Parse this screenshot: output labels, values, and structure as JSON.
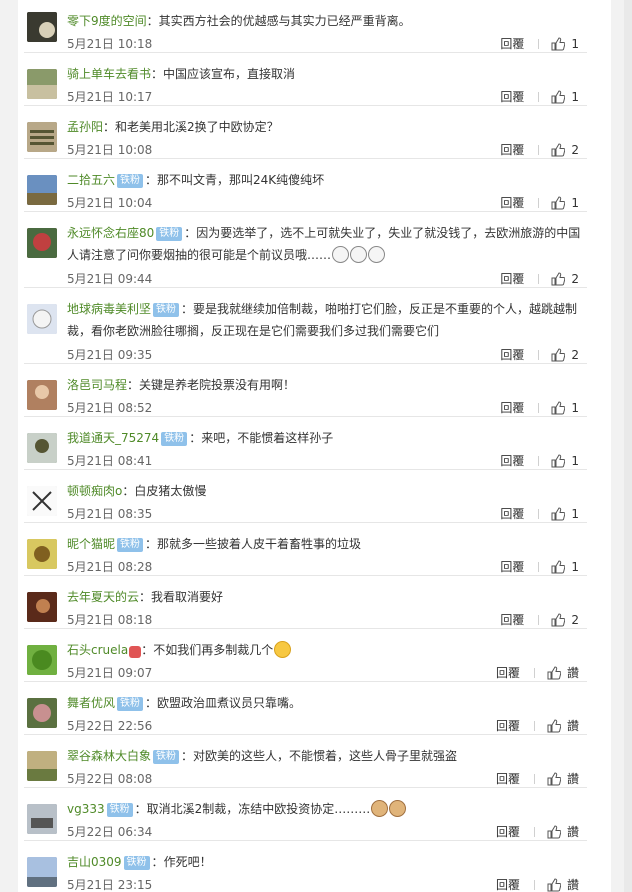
{
  "comments": [
    {
      "user": "零下9度的空间",
      "badge": "",
      "text": "其实西方社会的优越感与其实力已经严重背离。",
      "text2": "",
      "emoji": "",
      "time": "5月21日 10:18",
      "reply": "回覆",
      "likes": "1",
      "avatar_color": "#4a4a3a"
    },
    {
      "user": "骑上单车去看书",
      "badge": "",
      "text": "中国应该宣布，直接取消",
      "text2": "",
      "emoji": "",
      "time": "5月21日 10:17",
      "reply": "回覆",
      "likes": "1",
      "avatar_color": "#7a8a5a"
    },
    {
      "user": "孟孙阳",
      "badge": "",
      "text": "和老美用北溪2换了中欧协定？",
      "text2": "",
      "emoji": "",
      "time": "5月21日 10:08",
      "reply": "回覆",
      "likes": "2",
      "avatar_color": "#8a7a60"
    },
    {
      "user": "二拾五六",
      "badge": "铁粉",
      "text": "那不叫文青，那叫24K纯傻纯坏",
      "text2": "",
      "emoji": "",
      "time": "5月21日 10:04",
      "reply": "回覆",
      "likes": "1",
      "avatar_color": "#5a7aa0"
    },
    {
      "user": "永远怀念右座80",
      "badge": "铁粉",
      "text": "因为要选举了，选不上可就失业了，失业了就没钱了，去欧洲旅游的中国",
      "text2": "人请注意了问你要烟抽的很可能是个前议员哦……",
      "emoji": "face3",
      "time": "5月21日 09:44",
      "reply": "回覆",
      "likes": "2",
      "avatar_color": "#a04040"
    },
    {
      "user": "地球病毒美利坚",
      "badge": "铁粉",
      "text": "要是我就继续加倍制裁，啪啪打它们脸，反正是不重要的个人，越跳越制",
      "text2": "裁，看你老欧洲脸往哪搁，反正现在是它们需要我们多过我们需要它们",
      "emoji": "",
      "time": "5月21日 09:35",
      "reply": "回覆",
      "likes": "2",
      "avatar_color": "#c0c0d0"
    },
    {
      "user": "洛邑司马程",
      "badge": "",
      "text": "关键是养老院投票没有用啊！",
      "text2": "",
      "emoji": "",
      "time": "5月21日 08:52",
      "reply": "回覆",
      "likes": "1",
      "avatar_color": "#9a6a50"
    },
    {
      "user": "我道通天_75274",
      "badge": "铁粉",
      "text": "来吧，不能惯着这样孙子",
      "text2": "",
      "emoji": "",
      "time": "5月21日 08:41",
      "reply": "回覆",
      "likes": "1",
      "avatar_color": "#6a7a6a"
    },
    {
      "user": "顿顿痴肉o",
      "badge": "",
      "text": "白皮猪太傲慢",
      "text2": "",
      "emoji": "",
      "time": "5月21日 08:35",
      "reply": "回覆",
      "likes": "1",
      "avatar_color": "#d0d0d0"
    },
    {
      "user": "昵个猫昵",
      "badge": "铁粉",
      "text": "那就多一些披着人皮干着畜牲事的垃圾",
      "text2": "",
      "emoji": "",
      "time": "5月21日 08:28",
      "reply": "回覆",
      "likes": "1",
      "avatar_color": "#b0a040"
    },
    {
      "user": "去年夏天的云",
      "badge": "",
      "text": "我看取消要好",
      "text2": "",
      "emoji": "",
      "time": "5月21日 08:18",
      "reply": "回覆",
      "likes": "2",
      "avatar_color": "#7a3020"
    },
    {
      "user": "石头cruela",
      "badge": "",
      "text": "不如我们再多制裁几个",
      "text2": "",
      "emoji": "smile",
      "time": "5月21日 09:07",
      "reply": "回覆",
      "likes": "讚",
      "avatar_color": "#5a9a30"
    },
    {
      "user": "舞者优风",
      "badge": "铁粉",
      "text": "欧盟政治皿煮议员只靠嘴。",
      "text2": "",
      "emoji": "",
      "time": "5月22日 22:56",
      "reply": "回覆",
      "likes": "讚",
      "avatar_color": "#7a8a60"
    },
    {
      "user": "翠谷森林大白象",
      "badge": "铁粉",
      "text": "对欧美的这些人，不能惯着，这些人骨子里就强盗",
      "text2": "",
      "emoji": "",
      "time": "5月22日 08:08",
      "reply": "回覆",
      "likes": "讚",
      "avatar_color": "#a08a50"
    },
    {
      "user": "vg333",
      "badge": "铁粉",
      "text": "取消北溪2制裁，冻结中欧投资协定………",
      "text2": "",
      "emoji": "cat2",
      "time": "5月22日 06:34",
      "reply": "回覆",
      "likes": "讚",
      "avatar_color": "#808890"
    },
    {
      "user": "吉山0309",
      "badge": "铁粉",
      "text": "作死吧！",
      "text2": "",
      "emoji": "",
      "time": "5月21日 23:15",
      "reply": "回覆",
      "likes": "讚",
      "avatar_color": "#8aa0c0"
    }
  ]
}
